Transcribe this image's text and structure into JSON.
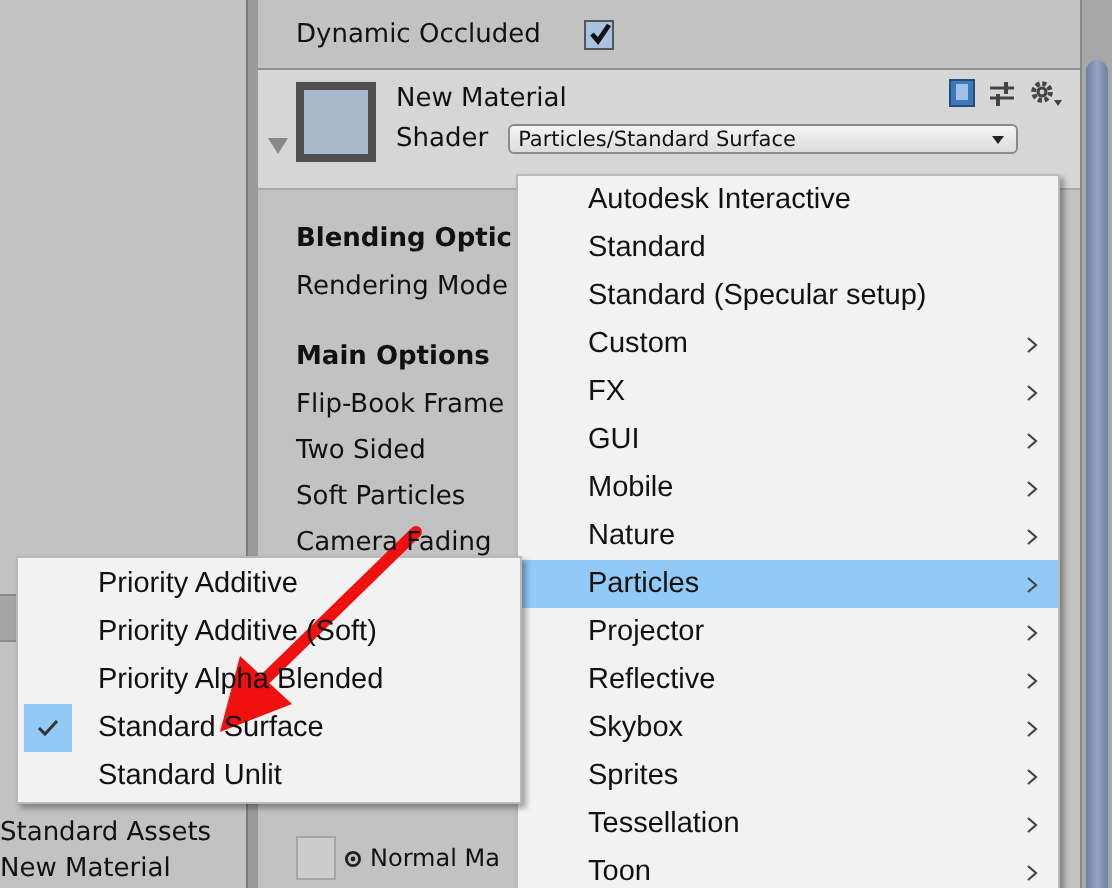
{
  "project_panel": {
    "items": [
      "Standard Assets",
      "New Material"
    ]
  },
  "inspector": {
    "dynamic_occluded": {
      "label": "Dynamic Occluded",
      "checked": true
    },
    "material": {
      "name": "New Material",
      "shader_label": "Shader",
      "shader": "Particles/Standard Surface"
    },
    "rows": [
      {
        "kind": "heading",
        "label": "Blending Optic"
      },
      {
        "kind": "row",
        "label": "Rendering Mode"
      },
      {
        "kind": "heading",
        "label": "Main Options"
      },
      {
        "kind": "row",
        "label": "Flip-Book Frame"
      },
      {
        "kind": "row",
        "label": "Two Sided"
      },
      {
        "kind": "row",
        "label": "Soft Particles"
      },
      {
        "kind": "row",
        "label": "Camera Fading"
      }
    ],
    "normal_map": {
      "label": "Normal Ma"
    }
  },
  "shader_menu": [
    {
      "label": "Autodesk Interactive",
      "submenu": false,
      "selected": false
    },
    {
      "label": "Standard",
      "submenu": false,
      "selected": false
    },
    {
      "label": "Standard (Specular setup)",
      "submenu": false,
      "selected": false
    },
    {
      "label": "Custom",
      "submenu": true,
      "selected": false
    },
    {
      "label": "FX",
      "submenu": true,
      "selected": false
    },
    {
      "label": "GUI",
      "submenu": true,
      "selected": false
    },
    {
      "label": "Mobile",
      "submenu": true,
      "selected": false
    },
    {
      "label": "Nature",
      "submenu": true,
      "selected": false
    },
    {
      "label": "Particles",
      "submenu": true,
      "selected": true
    },
    {
      "label": "Projector",
      "submenu": true,
      "selected": false
    },
    {
      "label": "Reflective",
      "submenu": true,
      "selected": false
    },
    {
      "label": "Skybox",
      "submenu": true,
      "selected": false
    },
    {
      "label": "Sprites",
      "submenu": true,
      "selected": false
    },
    {
      "label": "Tessellation",
      "submenu": true,
      "selected": false
    },
    {
      "label": "Toon",
      "submenu": true,
      "selected": false
    }
  ],
  "particles_submenu": [
    {
      "label": "Priority Additive",
      "checked": false
    },
    {
      "label": "Priority Additive (Soft)",
      "checked": false
    },
    {
      "label": "Priority Alpha Blended",
      "checked": false
    },
    {
      "label": "Standard Surface",
      "checked": true
    },
    {
      "label": "Standard Unlit",
      "checked": false
    }
  ]
}
